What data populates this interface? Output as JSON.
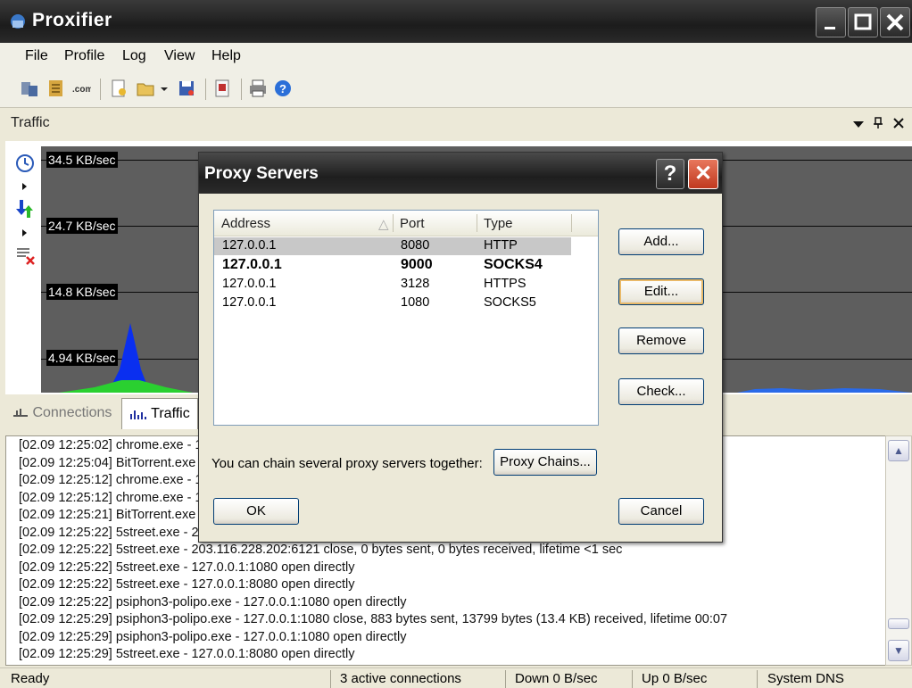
{
  "app": {
    "title": "Proxifier",
    "window_buttons": {
      "minimize": "_",
      "maximize": "☐",
      "close": "✕"
    }
  },
  "menu": [
    "File",
    "Profile",
    "Log",
    "View",
    "Help"
  ],
  "toolbar": {
    "icons": [
      "proxy-servers-icon",
      "proxification-rules-icon",
      "name-resolution-icon",
      "new-profile-icon",
      "open-profile-icon",
      "save-profile-icon",
      "advanced-icon",
      "print-icon",
      "help-icon"
    ]
  },
  "traffic": {
    "title": "Traffic",
    "pane_controls": [
      "▼",
      "ᵖ",
      "✕"
    ],
    "graph_labels": [
      "34.5 KB/sec",
      "24.7 KB/sec",
      "14.8 KB/sec",
      "4.94 KB/sec"
    ]
  },
  "tabs": [
    {
      "label": "Connections",
      "icon": "connections-icon"
    },
    {
      "label": "Traffic",
      "icon": "traffic-chart-icon"
    }
  ],
  "log": {
    "lines": [
      "[02.09 12:25:02] chrome.exe - 1",
      "[02.09 12:25:04] BitTorrent.exe",
      "[02.09 12:25:12] chrome.exe - 1",
      "[02.09 12:25:12] chrome.exe - 1",
      "[02.09 12:25:21] BitTorrent.exe",
      "[02.09 12:25:22] 5street.exe - 2",
      "[02.09 12:25:22] 5street.exe - 203.116.228.202:6121 close, 0 bytes sent, 0 bytes received, lifetime <1 sec",
      "[02.09 12:25:22] 5street.exe - 127.0.0.1:1080 open directly",
      "[02.09 12:25:22] 5street.exe - 127.0.0.1:8080 open directly",
      "[02.09 12:25:22] psiphon3-polipo.exe - 127.0.0.1:1080 open directly",
      "[02.09 12:25:29] psiphon3-polipo.exe - 127.0.0.1:1080 close, 883 bytes sent, 13799 bytes (13.4 KB) received, lifetime 00:07",
      "[02.09 12:25:29] psiphon3-polipo.exe - 127.0.0.1:1080 open directly",
      "[02.09 12:25:29] 5street.exe - 127.0.0.1:8080 open directly"
    ]
  },
  "statusbar": {
    "ready": "Ready",
    "connections": "3 active connections",
    "down": "Down 0 B/sec",
    "up": "Up 0 B/sec",
    "dns": "System DNS"
  },
  "dialog": {
    "title": "Proxy Servers",
    "help_label": "?",
    "close_label": "✕",
    "columns": [
      "Address",
      "Port",
      "Type"
    ],
    "sort_indicator": "△",
    "servers": [
      {
        "address": "127.0.0.1",
        "port": "8080",
        "type": "HTTP"
      },
      {
        "address": "127.0.0.1",
        "port": "9000",
        "type": "SOCKS4"
      },
      {
        "address": "127.0.0.1",
        "port": "3128",
        "type": "HTTPS"
      },
      {
        "address": "127.0.0.1",
        "port": "1080",
        "type": "SOCKS5"
      }
    ],
    "buttons": {
      "add": "Add...",
      "edit": "Edit...",
      "remove": "Remove",
      "check": "Check...",
      "chains": "Proxy Chains...",
      "ok": "OK",
      "cancel": "Cancel"
    },
    "chain_text": "You can chain several proxy servers together:"
  },
  "colors": {
    "graph_bg": "#5e5e5e",
    "traffic_down": "#0033ff",
    "traffic_up": "#22cc22",
    "dialog_close": "#d4462a"
  }
}
